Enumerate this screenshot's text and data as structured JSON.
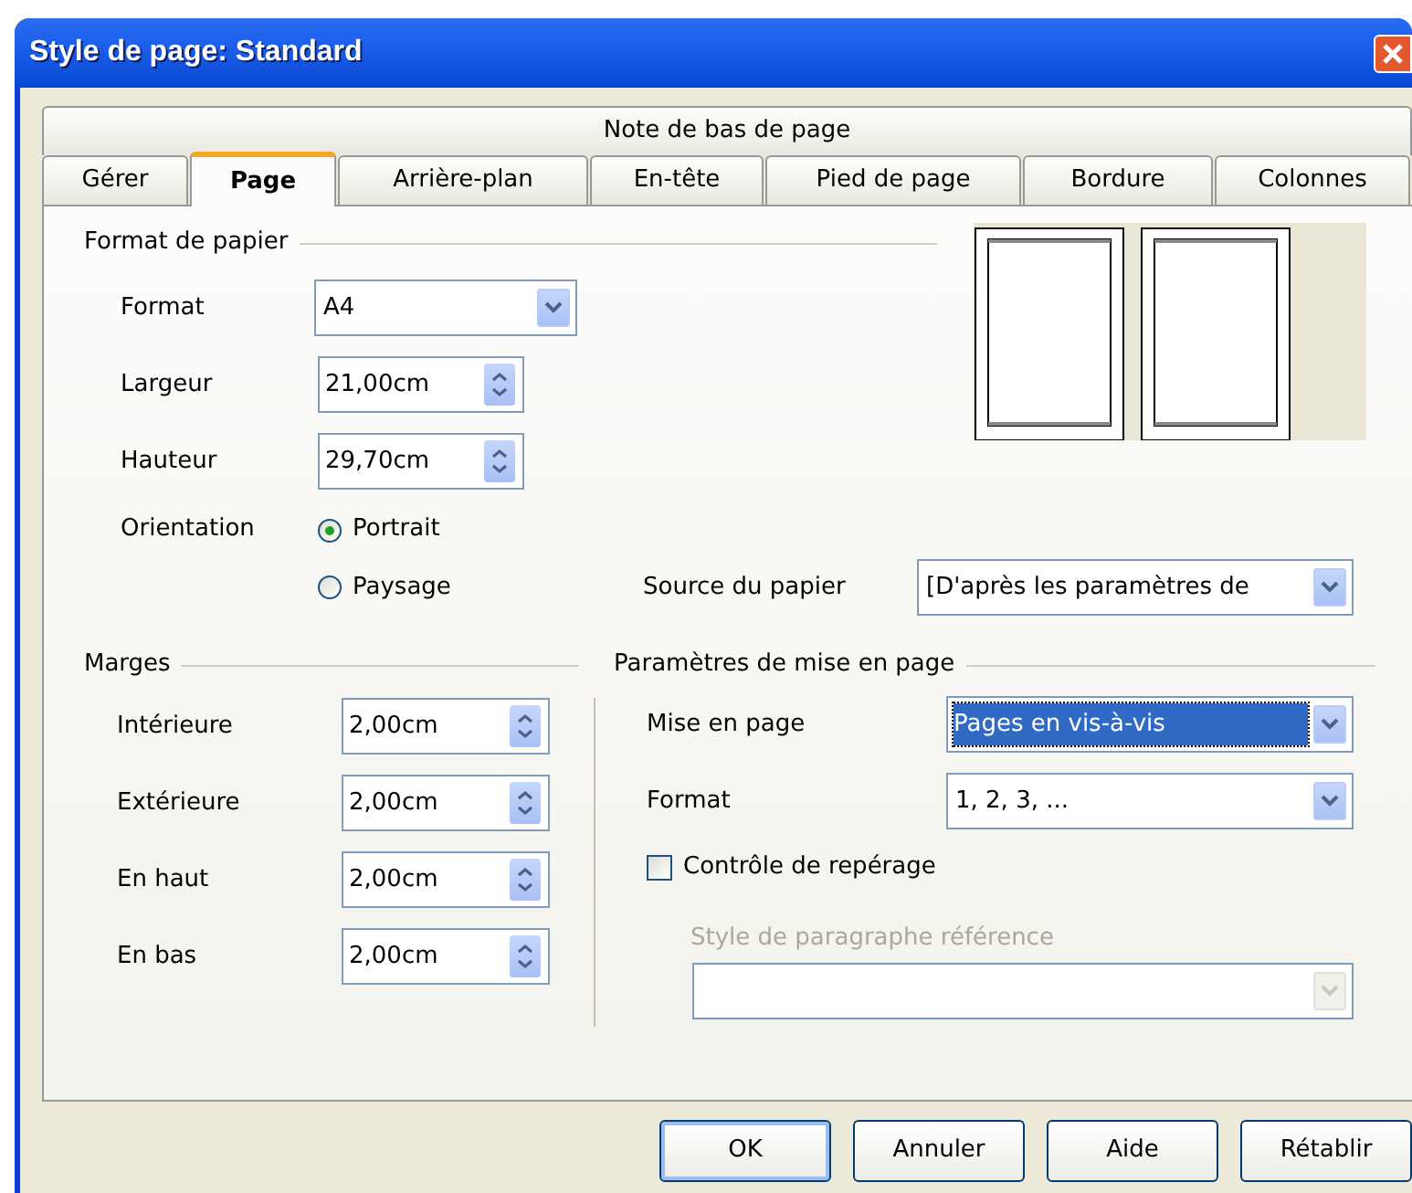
{
  "window": {
    "title": "Style de page: Standard"
  },
  "tabs_back_row": [
    {
      "label": "Note de bas de page",
      "selected": false
    }
  ],
  "tabs_front_row": [
    {
      "label": "Gérer",
      "selected": false
    },
    {
      "label": "Page",
      "selected": true
    },
    {
      "label": "Arrière-plan",
      "selected": false
    },
    {
      "label": "En-tête",
      "selected": false
    },
    {
      "label": "Pied de page",
      "selected": false
    },
    {
      "label": "Bordure",
      "selected": false
    },
    {
      "label": "Colonnes",
      "selected": false
    }
  ],
  "paper_format": {
    "title": "Format de papier",
    "format": {
      "label": "Format",
      "value": "A4"
    },
    "width": {
      "label": "Largeur",
      "value": "21,00cm"
    },
    "height": {
      "label": "Hauteur",
      "value": "29,70cm"
    },
    "orientation": {
      "label": "Orientation",
      "options": [
        {
          "label": "Portrait",
          "selected": true
        },
        {
          "label": "Paysage",
          "selected": false
        }
      ]
    },
    "paper_source": {
      "label": "Source du papier",
      "value": "[D'après les paramètres de"
    }
  },
  "margins": {
    "title": "Marges",
    "fields": [
      {
        "label": "Intérieure",
        "value": "2,00cm"
      },
      {
        "label": "Extérieure",
        "value": "2,00cm"
      },
      {
        "label": "En haut",
        "value": "2,00cm"
      },
      {
        "label": "En bas",
        "value": "2,00cm"
      }
    ]
  },
  "layout_settings": {
    "title": "Paramètres de mise en page",
    "page_layout": {
      "label": "Mise en page",
      "value": "Pages en vis-à-vis",
      "focused": true
    },
    "format": {
      "label": "Format",
      "value": "1, 2, 3, ..."
    },
    "register_true": {
      "label": "Contrôle de repérage",
      "checked": false
    },
    "reference_style": {
      "label": "Style de paragraphe référence",
      "disabled": true
    }
  },
  "buttons": [
    {
      "label": "OK",
      "default": true
    },
    {
      "label": "Annuler",
      "default": false
    },
    {
      "label": "Aide",
      "default": false
    },
    {
      "label": "Rétablir",
      "default": false
    }
  ]
}
